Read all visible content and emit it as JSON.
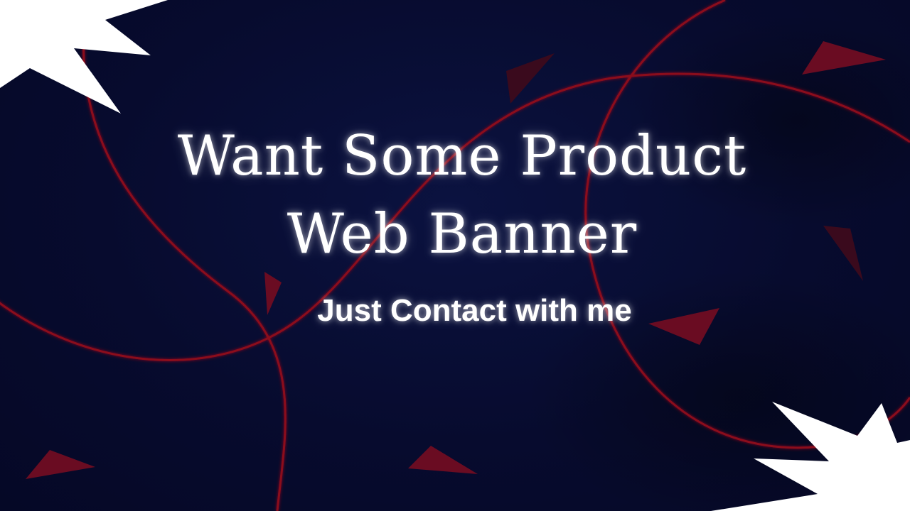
{
  "banner": {
    "title_line1": "Want Some Product",
    "title_line2": "Web Banner",
    "subtitle": "Just Contact with me"
  },
  "colors": {
    "background": "#070b2e",
    "accent_curve": "#8b0f1e",
    "accent_shard": "#5c0a1c",
    "text": "#ffffff",
    "starburst": "#ffffff"
  },
  "icons": [
    "starburst-icon",
    "triangle-shard-icon"
  ]
}
